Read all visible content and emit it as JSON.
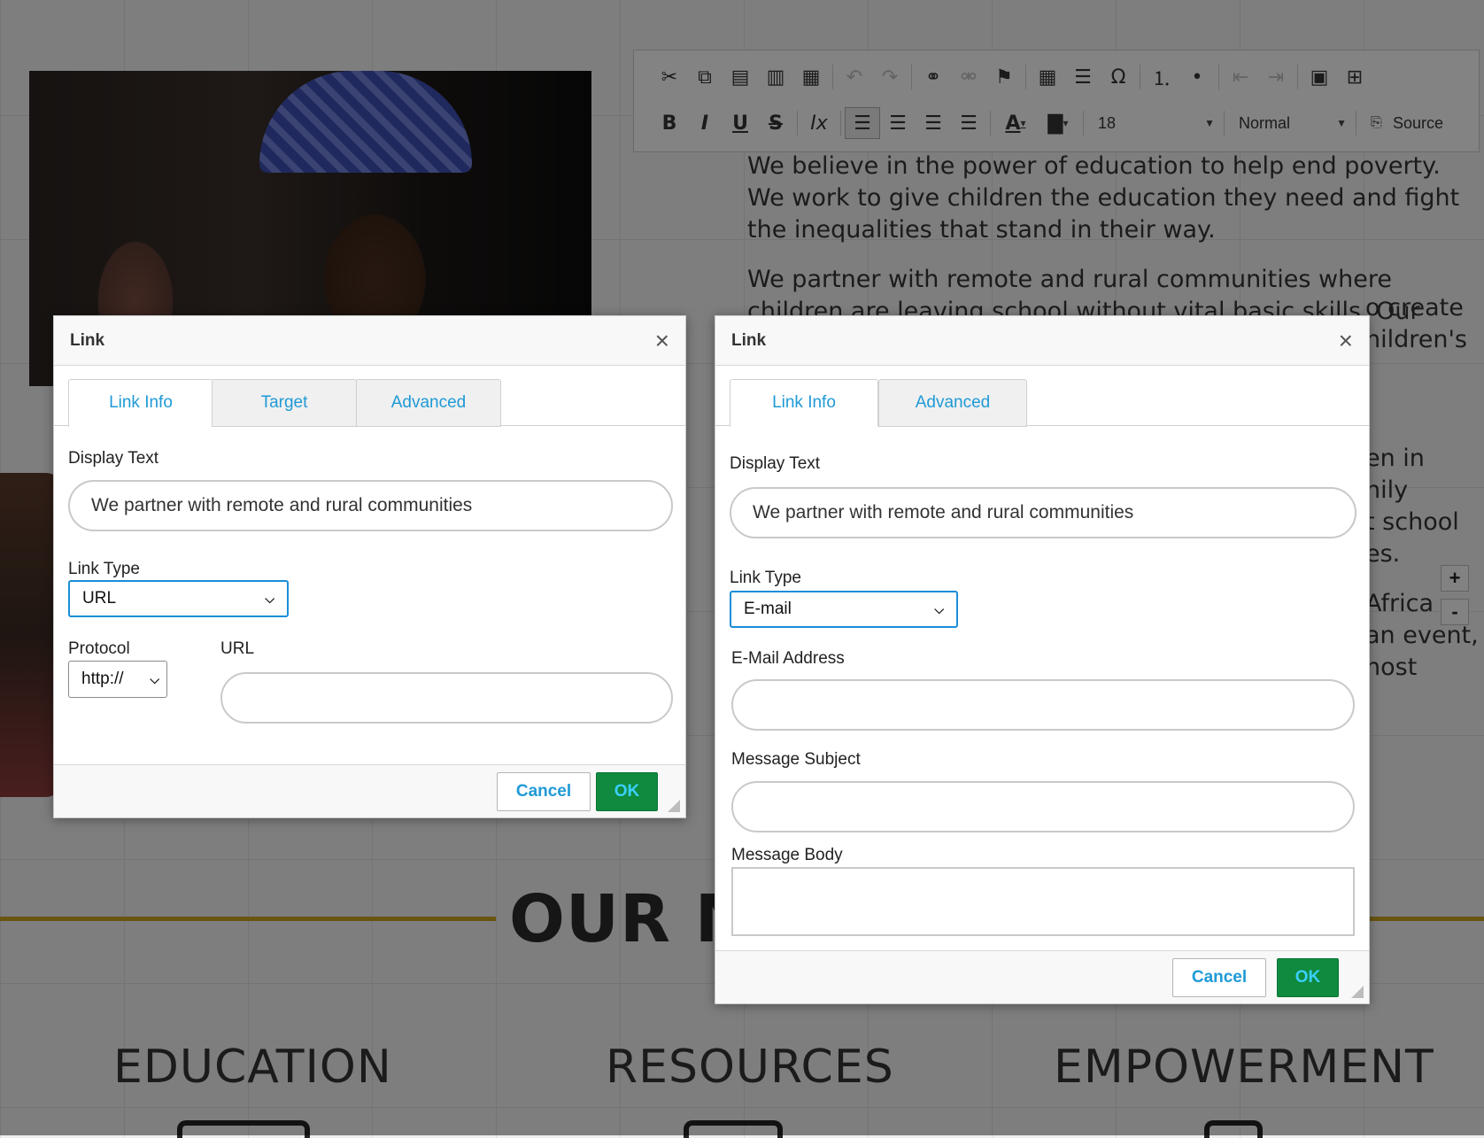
{
  "background": {
    "paragraphs": [
      "We believe in the power of education to help end poverty. We work to give children the education they need and fight the inequalities that stand in their way.",
      "We partner with remote and rural communities where children are leaving school without vital basic skills. Our"
    ],
    "fragments": [
      "o create",
      "nildren's"
    ],
    "fragments2": [
      "en in",
      "nily",
      "t school",
      "es."
    ],
    "fragments3": [
      "Africa",
      "an event,",
      "nost"
    ],
    "mission_title": "OUR M",
    "pillars": [
      "EDUCATION",
      "RESOURCES",
      "EMPOWERMENT"
    ],
    "zoom_in": "+",
    "zoom_out": "-"
  },
  "toolbar": {
    "font_size": "18",
    "format": "Normal",
    "source_label": "Source",
    "row1_icons": [
      "cut-icon",
      "copy-icon",
      "paste-icon",
      "paste-text-icon",
      "paste-word-icon",
      "undo-icon",
      "redo-icon",
      "link-icon",
      "unlink-icon",
      "anchor-icon",
      "table-icon",
      "horizontal-line-icon",
      "special-char-icon",
      "numbered-list-icon",
      "bulleted-list-icon",
      "decrease-indent-icon",
      "increase-indent-icon",
      "image-icon",
      "insert-widget-icon"
    ],
    "row2_icons": [
      "bold-icon",
      "italic-icon",
      "underline-icon",
      "strikethrough-icon",
      "remove-format-icon",
      "align-left-icon",
      "align-center-icon",
      "align-right-icon",
      "justify-icon",
      "text-color-icon",
      "background-color-icon",
      "source-icon"
    ]
  },
  "dialog_left": {
    "title": "Link",
    "tabs": [
      "Link Info",
      "Target",
      "Advanced"
    ],
    "display_text_label": "Display Text",
    "display_text_value": "We partner with remote and rural communities",
    "link_type_label": "Link Type",
    "link_type_value": "URL",
    "protocol_label": "Protocol",
    "protocol_value": "http://",
    "url_label": "URL",
    "url_value": "",
    "cancel_label": "Cancel",
    "ok_label": "OK"
  },
  "dialog_right": {
    "title": "Link",
    "tabs": [
      "Link Info",
      "Advanced"
    ],
    "display_text_label": "Display Text",
    "display_text_value": "We partner with remote and rural communities",
    "link_type_label": "Link Type",
    "link_type_value": "E-mail",
    "email_label": "E-Mail Address",
    "email_value": "",
    "subject_label": "Message Subject",
    "subject_value": "",
    "body_label": "Message Body",
    "body_value": "",
    "cancel_label": "Cancel",
    "ok_label": "OK"
  },
  "colors": {
    "accent_blue": "#1f9ad6",
    "ok_green": "#0f8a3e",
    "mission_gold": "#c8a01f"
  }
}
